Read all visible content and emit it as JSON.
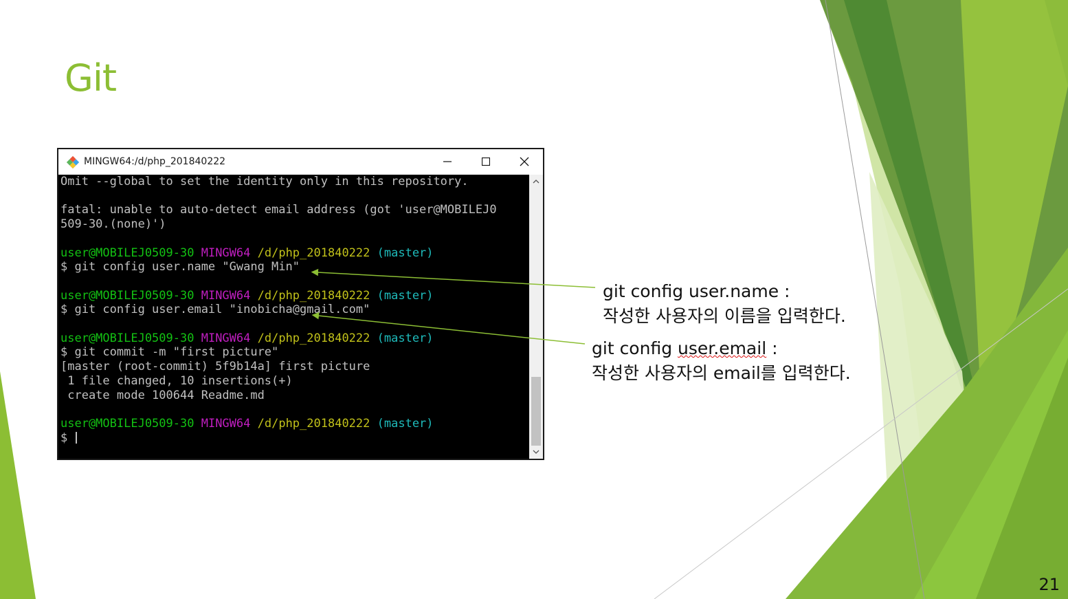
{
  "slide": {
    "title": "Git",
    "page_number": "21"
  },
  "window": {
    "title": "MINGW64:/d/php_201840222",
    "icon": "git-diamond-icon",
    "controls": [
      "minimize-icon",
      "maximize-icon",
      "close-icon"
    ]
  },
  "terminal": {
    "lines": [
      "Omit --global to set the identity only in this repository.",
      "",
      "fatal: unable to auto-detect email address (got 'user@MOBILEJ0",
      "509-30.(none)')",
      "",
      "$ git config user.name \"Gwang Min\"",
      "",
      "$ git config user.email \"inobicha@gmail.com\"",
      "",
      "$ git commit -m \"first picture\"",
      "[master (root-commit) 5f9b14a] first picture",
      " 1 file changed, 10 insertions(+)",
      " create mode 100644 Readme.md",
      "",
      "$ "
    ],
    "prompt": {
      "user": "user@MOBILEJ0509-30",
      "system": "MINGW64",
      "path": "/d/php_201840222",
      "branch": "(master)"
    },
    "colors": {
      "background": "#000000",
      "text": "#c0c0c0",
      "user": "#13c113",
      "system": "#bf1ebf",
      "path": "#c1c11a",
      "branch": "#1ebbbb"
    }
  },
  "annotations": [
    {
      "heading": "git config user.name :",
      "description": "작성한 사용자의 이름을 입력한다."
    },
    {
      "heading_prefix": "git config ",
      "heading_underlined": "user.email",
      "heading_suffix": " :",
      "description_prefix": "작성한 사용자의 ",
      "description_bold": "email",
      "description_suffix": "를 입력한다."
    }
  ],
  "theme": {
    "accent": "#8cbe34",
    "arrow": "#8cbe34"
  }
}
